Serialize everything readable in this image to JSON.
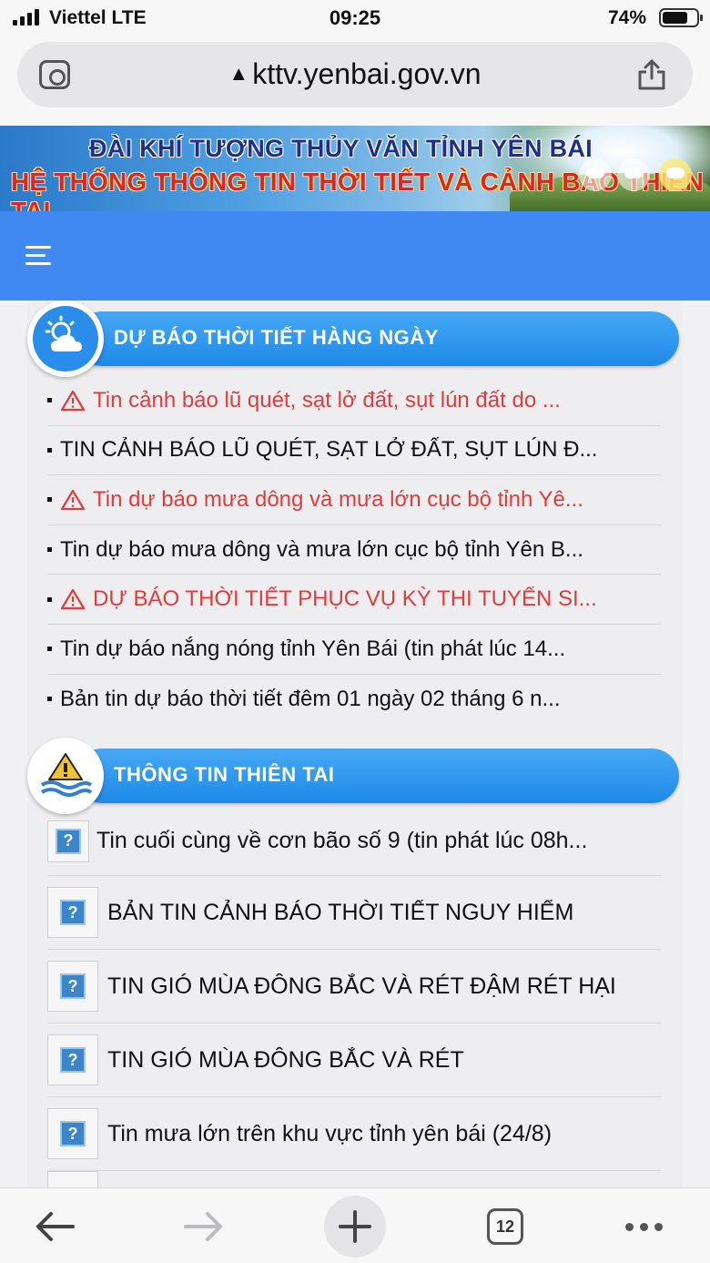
{
  "status": {
    "carrier": "Viettel  LTE",
    "time": "09:25",
    "battery": "74%"
  },
  "browser": {
    "url": "kttv.yenbai.gov.vn",
    "tab_count": "12"
  },
  "banner": {
    "line1": "ĐÀI KHÍ TƯỢNG THỦY VĂN TỈNH YÊN BÁI",
    "line2": "HỆ THỐNG THÔNG TIN THỜI TIẾT VÀ CẢNH BÁO THIÊN TAI"
  },
  "forecast": {
    "title": "DỰ BÁO THỜI TIẾT HÀNG NGÀY",
    "items": [
      {
        "text": "Tin cảnh báo lũ quét, sạt lở đất, sụt lún đất do ...",
        "alert": true
      },
      {
        "text": "TIN CẢNH BÁO LŨ QUÉT, SẠT LỞ ĐẤT, SỤT LÚN Đ...",
        "alert": false
      },
      {
        "text": "Tin dự báo mưa dông và mưa lớn cục bộ tỉnh Yê...",
        "alert": true
      },
      {
        "text": "Tin dự báo mưa dông và mưa lớn cục bộ tỉnh Yên B...",
        "alert": false
      },
      {
        "text": "DỰ BÁO THỜI TIẾT PHỤC VỤ KỲ THI TUYỂN SI...",
        "alert": true
      },
      {
        "text": "Tin dự báo nắng nóng tỉnh Yên Bái (tin phát lúc 14...",
        "alert": false
      },
      {
        "text": "Bản tin dự báo thời tiết đêm 01 ngày 02 tháng 6 n...",
        "alert": false
      }
    ]
  },
  "disaster": {
    "title": "THÔNG TIN THIÊN TAI",
    "items": [
      "Tin cuối cùng về cơn bão số 9 (tin phát lúc 08h...",
      "BẢN TIN CẢNH BÁO THỜI TIẾT NGUY HIỂM",
      "TIN GIÓ MÙA ĐÔNG BẮC VÀ RÉT ĐẬM RÉT HẠI",
      "TIN GIÓ MÙA ĐÔNG BẮC VÀ RÉT",
      "Tin mưa lớn trên khu vực tỉnh yên bái (24/8)"
    ],
    "icon_glyph": "?"
  },
  "colors": {
    "nav": "#4089f2",
    "pill": "#1e8ae8",
    "alert": "#e23b3b"
  }
}
